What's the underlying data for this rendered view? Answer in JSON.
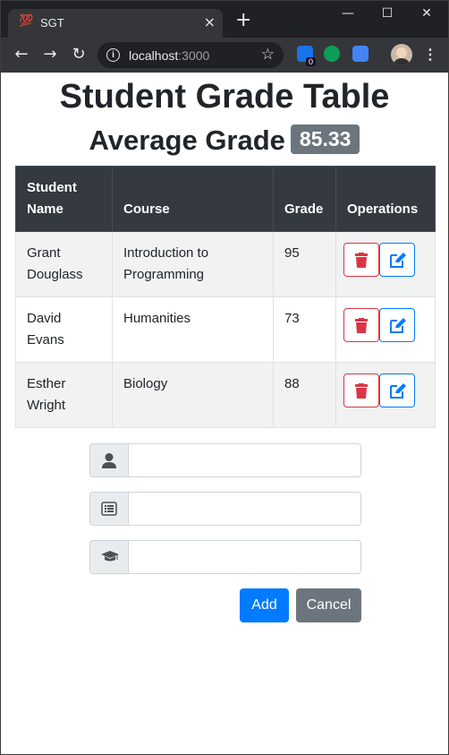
{
  "browser": {
    "tab_title": "SGT",
    "tab_favicon": "💯",
    "tab_close_icon": "close-icon",
    "new_tab_label": "+",
    "url_host": "localhost",
    "url_port": ":3000",
    "extension_badge": "0",
    "minimize_label": "—",
    "maximize_label": "☐",
    "close_label": "✕"
  },
  "page": {
    "title": "Student Grade Table",
    "average_label": "Average Grade",
    "average_value": "85.33"
  },
  "table": {
    "headers": [
      "Student Name",
      "Course",
      "Grade",
      "Operations"
    ],
    "rows": [
      {
        "name": "Grant Douglass",
        "course": "Introduction to Programming",
        "grade": "95"
      },
      {
        "name": "David Evans",
        "course": "Humanities",
        "grade": "73"
      },
      {
        "name": "Esther Wright",
        "course": "Biology",
        "grade": "88"
      }
    ]
  },
  "form": {
    "name_value": "",
    "course_value": "",
    "grade_value": "",
    "add_label": "Add",
    "cancel_label": "Cancel"
  },
  "colors": {
    "primary": "#007bff",
    "danger": "#dc3545",
    "secondary": "#6c757d",
    "table_header": "#343a40"
  }
}
